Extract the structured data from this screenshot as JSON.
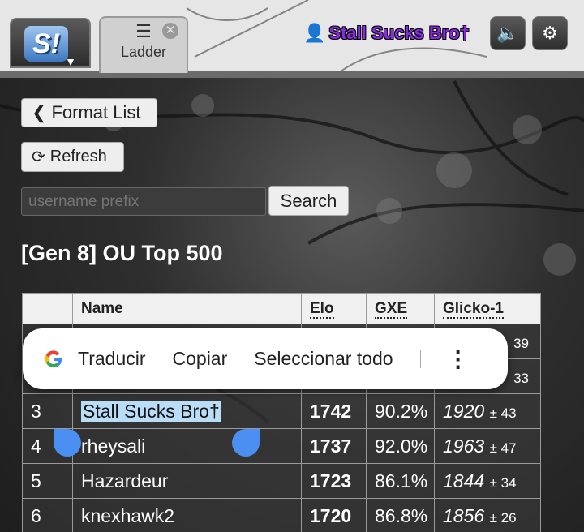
{
  "header": {
    "logo_text": "S!",
    "tab": {
      "label": "Ladder",
      "icon": "ladder-icon"
    },
    "user": {
      "name": "Stall Sucks Bro†",
      "icon": "user-icon"
    }
  },
  "controls": {
    "format_list_label": "Format List",
    "refresh_label": "Refresh",
    "search_placeholder": "username prefix",
    "search_label": "Search"
  },
  "ladder": {
    "title": "[Gen 8] OU Top 500",
    "columns": [
      "",
      "Name",
      "Elo",
      "GXE",
      "Glicko-1"
    ],
    "rows": [
      {
        "rank": "",
        "name": "",
        "elo": "",
        "gxe": "",
        "glicko": "",
        "dev": "39"
      },
      {
        "rank": "",
        "name": "",
        "elo": "",
        "gxe": "",
        "glicko": "",
        "dev": "33"
      },
      {
        "rank": "3",
        "name": "Stall Sucks Bro†",
        "elo": "1742",
        "gxe": "90.2%",
        "glicko": "1920",
        "dev": "± 43"
      },
      {
        "rank": "4",
        "name": "rheysali",
        "elo": "1737",
        "gxe": "92.0%",
        "glicko": "1963",
        "dev": "± 47"
      },
      {
        "rank": "5",
        "name": "Hazardeur",
        "elo": "1723",
        "gxe": "86.1%",
        "glicko": "1844",
        "dev": "± 34"
      },
      {
        "rank": "6",
        "name": "knexhawk2",
        "elo": "1720",
        "gxe": "86.8%",
        "glicko": "1856",
        "dev": "± 26"
      }
    ]
  },
  "context_menu": {
    "items": [
      "Traducir",
      "Copiar",
      "Seleccionar todo"
    ],
    "google_icon": "G"
  },
  "colors": {
    "username": "#8a2be2",
    "selection": "#b9dcf7",
    "handle": "#4c8ff2"
  }
}
